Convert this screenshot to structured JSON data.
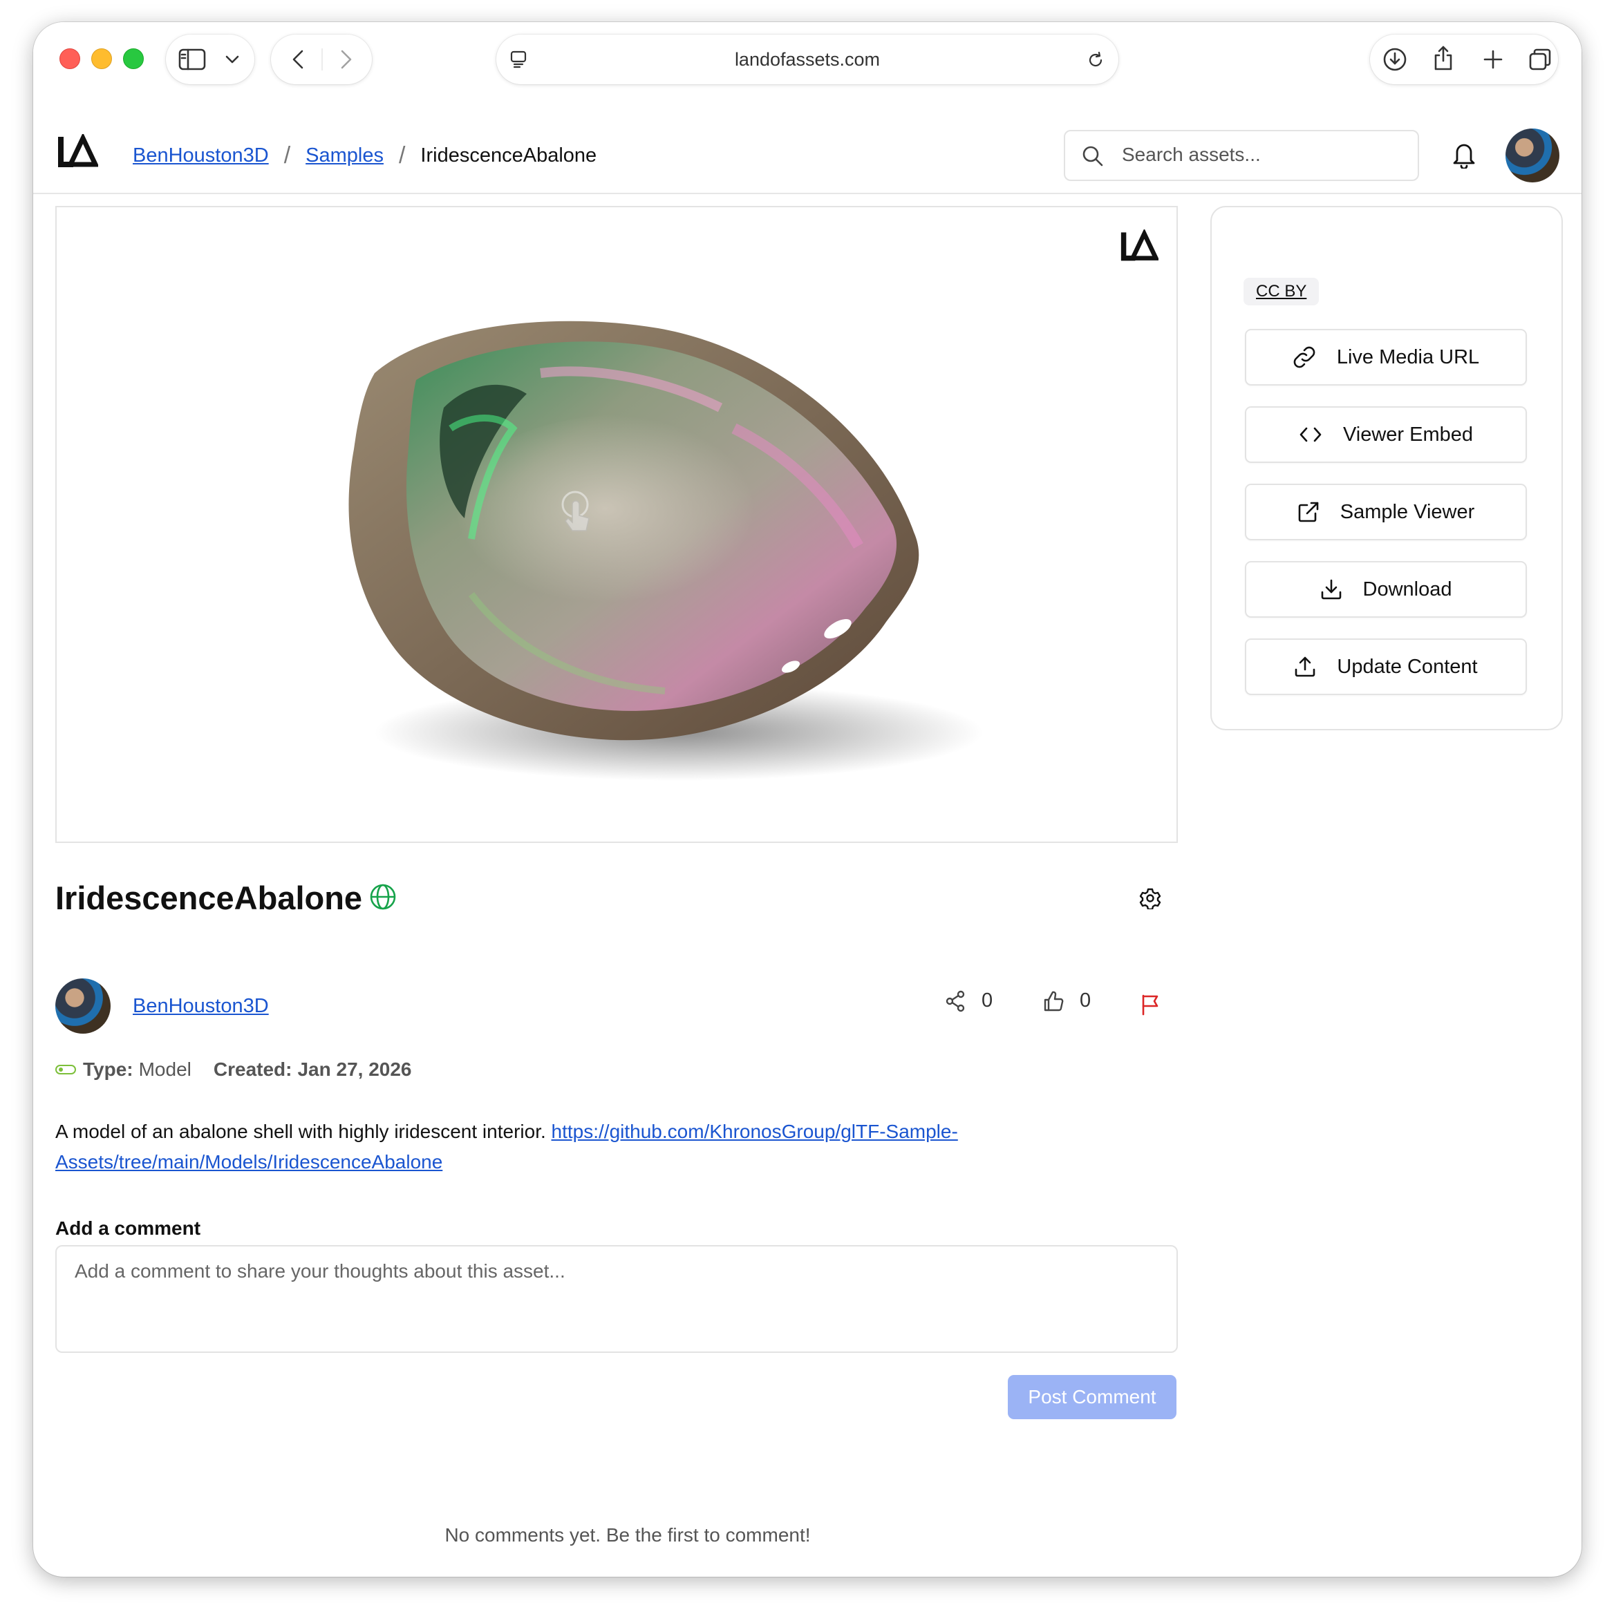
{
  "browser": {
    "url": "landofassets.com"
  },
  "header": {
    "breadcrumbs": [
      "BenHouston3D",
      "Samples",
      "IridescenceAbalone"
    ],
    "search_placeholder": "Search assets..."
  },
  "asset": {
    "title": "IridescenceAbalone",
    "visibility_icon": "globe-icon",
    "owner": "BenHouston3D",
    "shares": "0",
    "likes": "0",
    "type_label": "Type:",
    "type_value": "Model",
    "created_label": "Created:",
    "created_value": "Jan 27, 2026",
    "description": "A model of an abalone shell with highly iridescent interior.",
    "link_text": "https://github.com/KhronosGroup/glTF-Sample-Assets/tree/main/Models/IridescenceAbalone"
  },
  "sidebar": {
    "license": "CC BY",
    "buttons": [
      {
        "label": "Live Media URL",
        "icon": "link-icon"
      },
      {
        "label": "Viewer Embed",
        "icon": "code-icon"
      },
      {
        "label": "Sample Viewer",
        "icon": "external-link-icon"
      },
      {
        "label": "Download",
        "icon": "download-icon"
      },
      {
        "label": "Update Content",
        "icon": "upload-icon"
      }
    ]
  },
  "comments": {
    "label": "Add a comment",
    "placeholder": "Add a comment to share your thoughts about this asset...",
    "post_label": "Post Comment",
    "empty_text": "No comments yet. Be the first to comment!"
  },
  "colors": {
    "link": "#1a55d0",
    "accent_button": "#9bb3f5",
    "globe": "#16a34a",
    "flag": "#dc2626"
  }
}
